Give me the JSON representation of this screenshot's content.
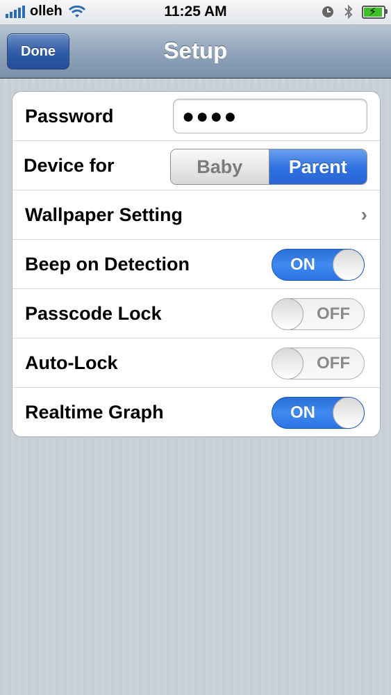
{
  "status_bar": {
    "carrier": "olleh",
    "time": "11:25 AM",
    "icons": [
      "signal-bars-icon",
      "wifi-icon",
      "clock-icon",
      "bluetooth-icon",
      "battery-charging-icon"
    ]
  },
  "nav_bar": {
    "title": "Setup",
    "done_label": "Done"
  },
  "settings": {
    "password": {
      "label": "Password",
      "value": "●●●●"
    },
    "device_for": {
      "label": "Device for",
      "options": [
        "Baby",
        "Parent"
      ],
      "selected": "Parent"
    },
    "wallpaper": {
      "label": "Wallpaper Setting"
    },
    "beep_on_detection": {
      "label": "Beep on Detection",
      "state": "ON"
    },
    "passcode_lock": {
      "label": "Passcode Lock",
      "state": "OFF"
    },
    "auto_lock": {
      "label": "Auto-Lock",
      "state": "OFF"
    },
    "realtime_graph": {
      "label": "Realtime Graph",
      "state": "ON"
    }
  },
  "colors": {
    "nav_bar": "#8ea2b9",
    "accent_blue": "#2e70e0",
    "background": "#c6ced6"
  }
}
